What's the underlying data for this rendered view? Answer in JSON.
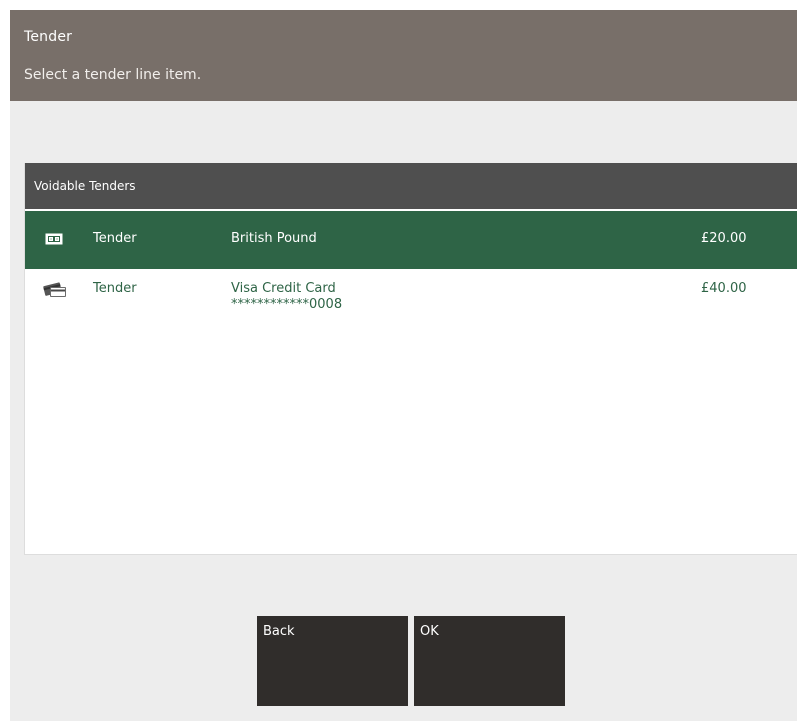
{
  "header": {
    "title": "Tender",
    "subtitle": "Select a tender line item."
  },
  "panel": {
    "title": "Voidable Tenders",
    "rows": [
      {
        "icon": "cash-icon",
        "type": "Tender",
        "description": "British Pound",
        "description_line2": "",
        "amount": "£20.00",
        "selected": true
      },
      {
        "icon": "credit-card-icon",
        "type": "Tender",
        "description": "Visa Credit Card",
        "description_line2": "************0008",
        "amount": "£40.00",
        "selected": false
      }
    ]
  },
  "buttons": {
    "back_label": "Back",
    "ok_label": "OK"
  },
  "colors": {
    "header_bg": "#786f69",
    "panel_header_bg": "#4f4f4f",
    "selected_row_bg": "#2e6446",
    "row_text": "#2e6446",
    "button_bg": "#302d2b",
    "page_bg": "#ededed"
  }
}
